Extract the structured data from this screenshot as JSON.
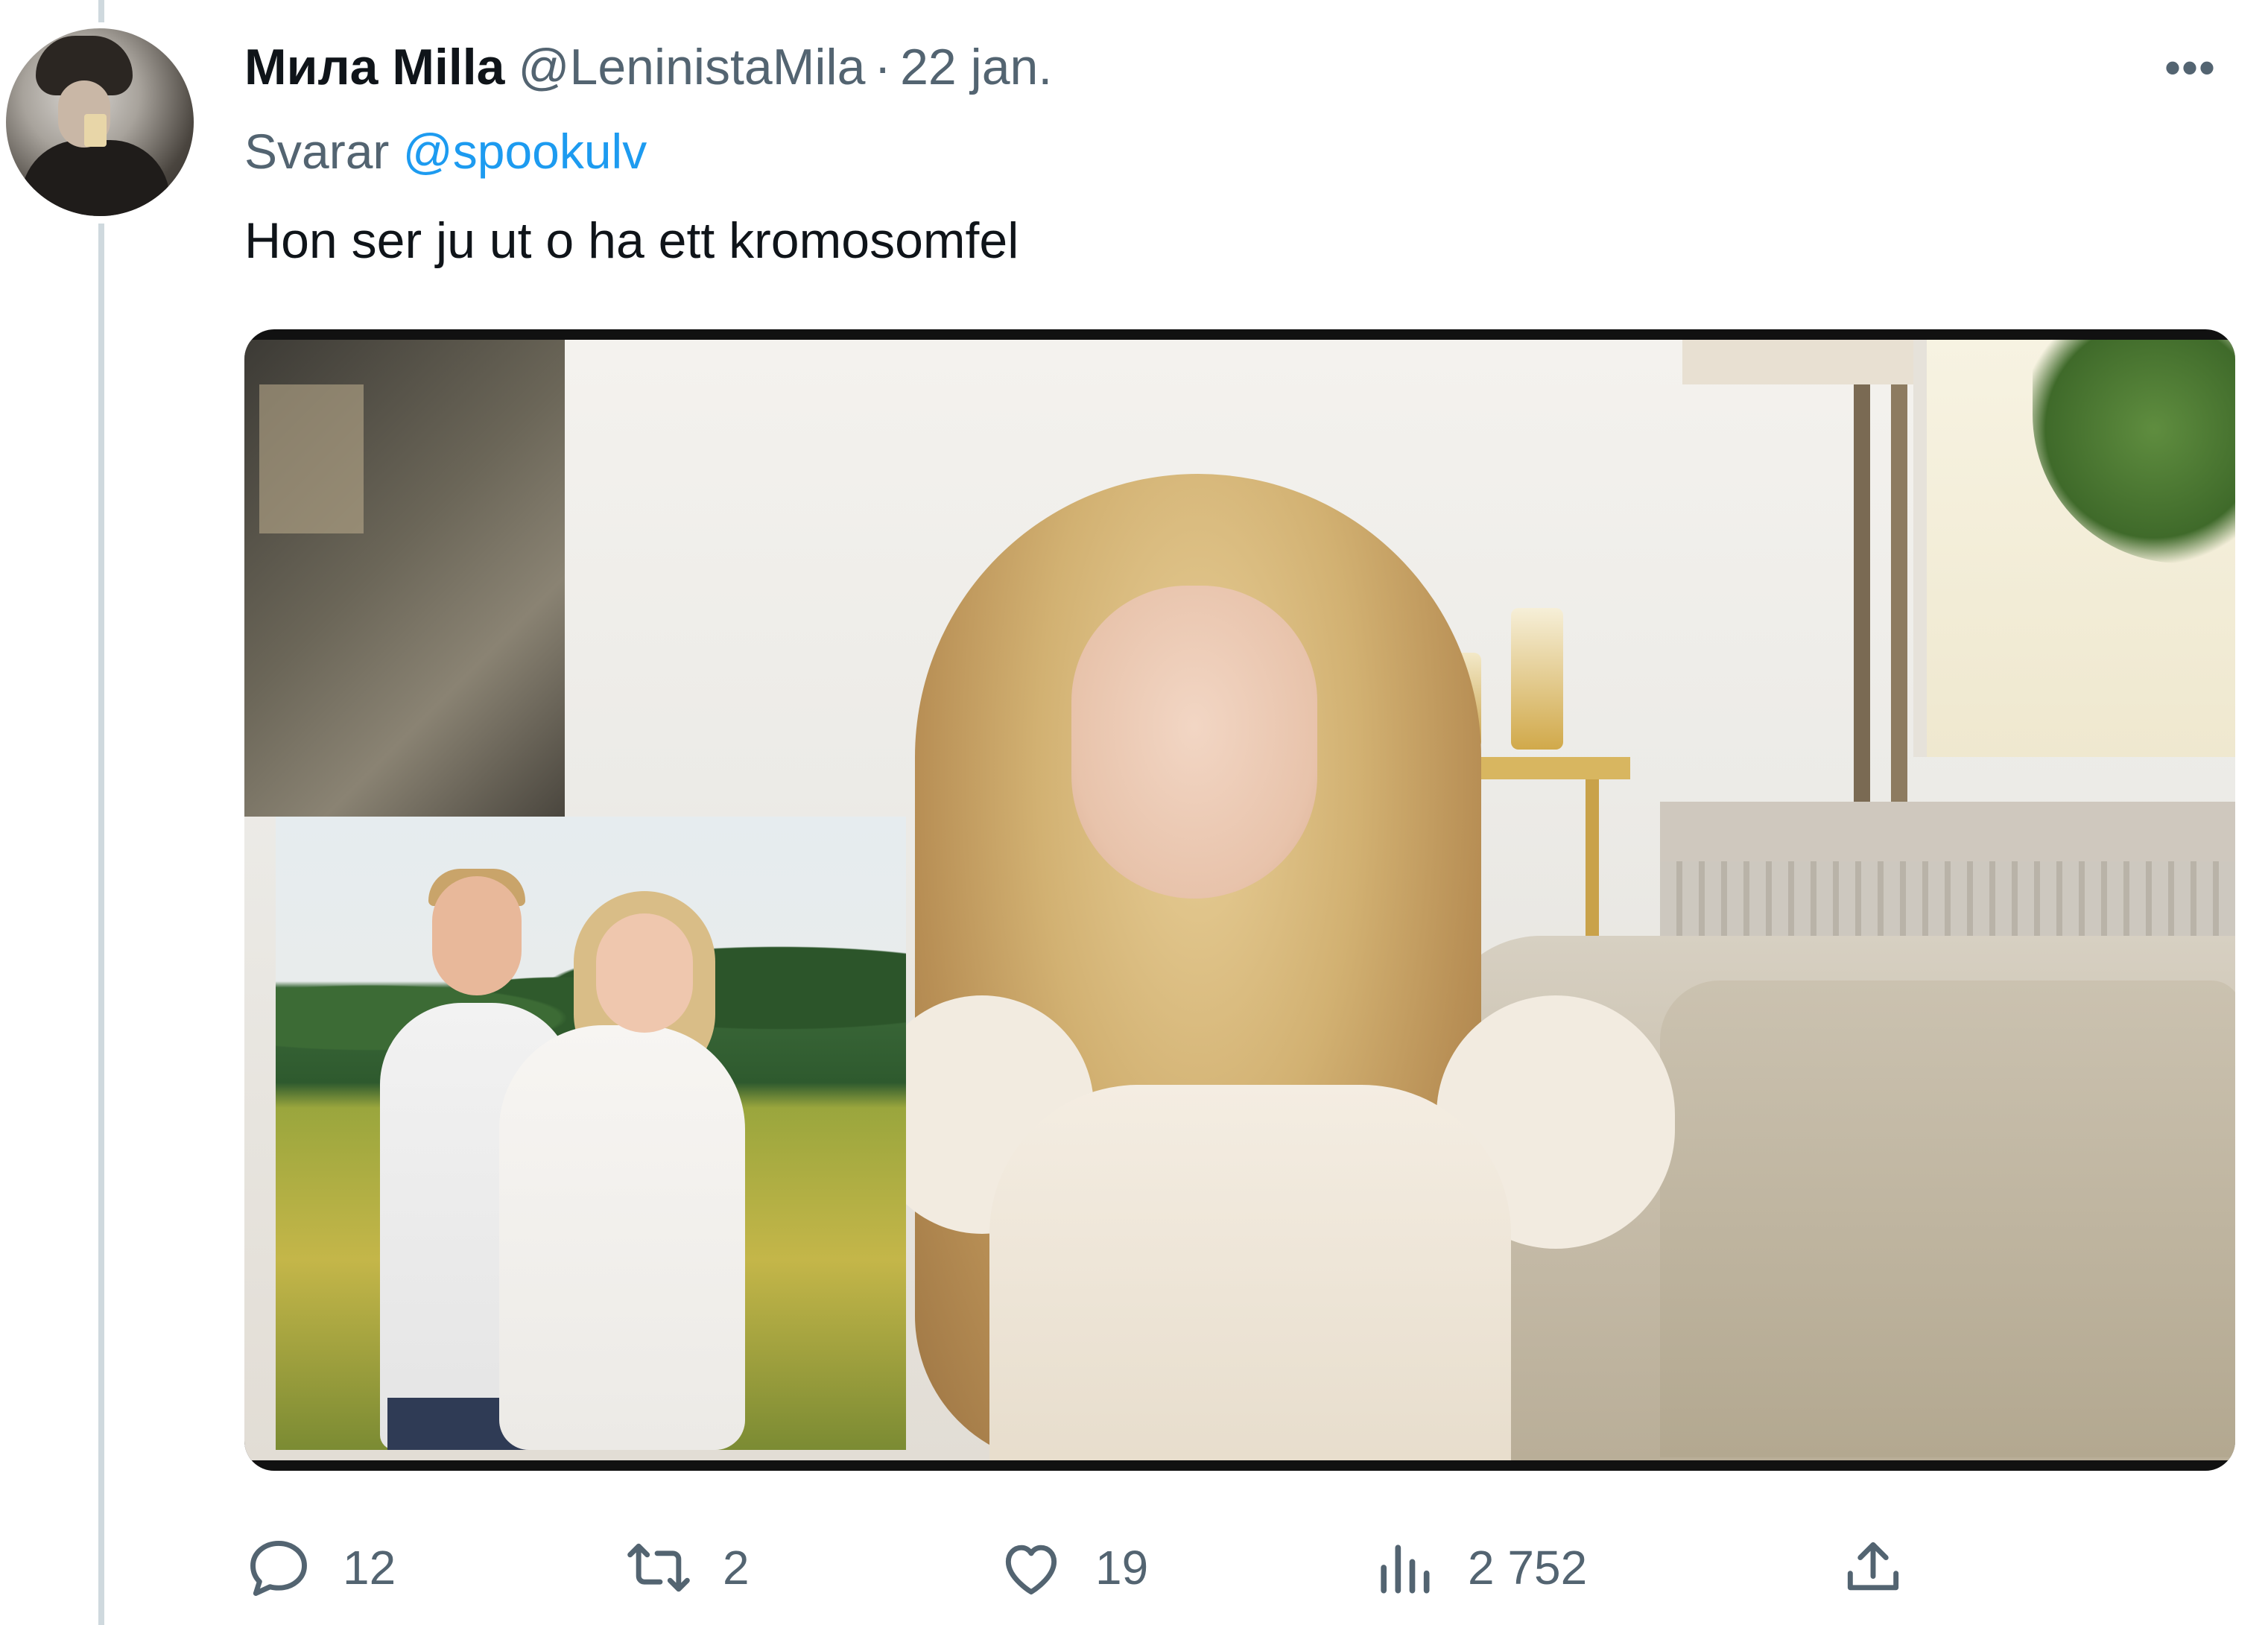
{
  "tweet": {
    "display_name": "Мила Milla",
    "handle": "@LeninistaMila",
    "separator": "·",
    "date": "22 jan.",
    "reply_prefix": "Svarar",
    "reply_to": "@spookulv",
    "text": "Hon ser ju ut o ha ett kromosomfel",
    "more_icon": "more-horizontal-icon"
  },
  "actions": {
    "replies": "12",
    "retweets": "2",
    "likes": "19",
    "views": "2 752"
  },
  "colors": {
    "text": "#0f1419",
    "secondary": "#536471",
    "mention": "#1d9bf0",
    "thread_line": "#cfd9de"
  }
}
